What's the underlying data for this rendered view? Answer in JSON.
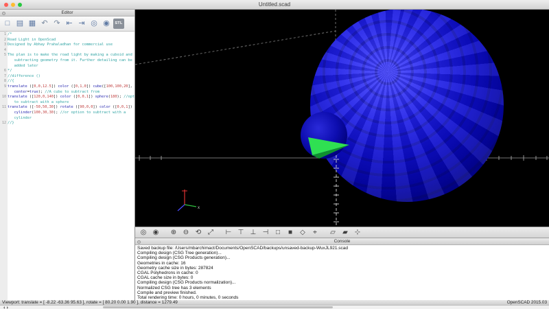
{
  "window": {
    "title": "Untitled.scad"
  },
  "editor": {
    "dock_title": "Editor",
    "toolbar": [
      {
        "name": "new-file",
        "glyph": "□"
      },
      {
        "name": "open-file",
        "glyph": "▤"
      },
      {
        "name": "save-file",
        "glyph": "▦"
      },
      {
        "name": "undo",
        "glyph": "↶"
      },
      {
        "name": "redo",
        "glyph": "↷"
      },
      {
        "name": "unindent",
        "glyph": "⇤"
      },
      {
        "name": "indent",
        "glyph": "⇥"
      },
      {
        "name": "preview",
        "glyph": "◎"
      },
      {
        "name": "render",
        "glyph": "◉"
      },
      {
        "name": "export-stl",
        "glyph": "STL"
      }
    ],
    "code_lines": [
      {
        "no": "1",
        "segs": [
          {
            "c": "cm",
            "t": "/*"
          }
        ]
      },
      {
        "no": "2",
        "segs": [
          {
            "c": "cm",
            "t": "Road Light in OpenScad"
          }
        ]
      },
      {
        "no": "3",
        "segs": [
          {
            "c": "cm",
            "t": "Designed by Abhay Prahaladhan for commercial use"
          }
        ]
      },
      {
        "no": "4",
        "segs": []
      },
      {
        "no": "5",
        "segs": [
          {
            "c": "cm",
            "t": "The plan is to make the road light by making a cuboid and"
          }
        ]
      },
      {
        "no": "",
        "segs": [
          {
            "c": "cm",
            "t": "   subtracting geometry from it. Further detailing can be"
          }
        ]
      },
      {
        "no": "",
        "segs": [
          {
            "c": "cm",
            "t": "   added later"
          }
        ]
      },
      {
        "no": "6",
        "segs": [
          {
            "c": "cm",
            "t": "*/"
          }
        ]
      },
      {
        "no": "7",
        "segs": [
          {
            "c": "cm",
            "t": "//difference ()"
          }
        ]
      },
      {
        "no": "8",
        "segs": [
          {
            "c": "cm",
            "t": "//{"
          }
        ]
      },
      {
        "no": "9",
        "segs": [
          {
            "c": "kw",
            "t": "translate"
          },
          {
            "c": "pl",
            "t": " (["
          },
          {
            "c": "num",
            "t": "0,0,12.5"
          },
          {
            "c": "pl",
            "t": "]) "
          },
          {
            "c": "kw",
            "t": "color"
          },
          {
            "c": "pl",
            "t": " (["
          },
          {
            "c": "num",
            "t": "0,1,0"
          },
          {
            "c": "pl",
            "t": "]) "
          },
          {
            "c": "kw",
            "t": "cube"
          },
          {
            "c": "pl",
            "t": "(["
          },
          {
            "c": "num",
            "t": "100,100,20"
          },
          {
            "c": "pl",
            "t": "],"
          }
        ]
      },
      {
        "no": "",
        "segs": [
          {
            "c": "pl",
            "t": "   "
          },
          {
            "c": "kw",
            "t": "center"
          },
          {
            "c": "pl",
            "t": "="
          },
          {
            "c": "kw",
            "t": "true"
          },
          {
            "c": "pl",
            "t": "); "
          },
          {
            "c": "cm",
            "t": "//A cube to subtract from"
          }
        ]
      },
      {
        "no": "10",
        "segs": [
          {
            "c": "kw",
            "t": "translate"
          },
          {
            "c": "pl",
            "t": " (["
          },
          {
            "c": "num",
            "t": "120,0,140"
          },
          {
            "c": "pl",
            "t": "]) "
          },
          {
            "c": "kw",
            "t": "color"
          },
          {
            "c": "pl",
            "t": " (["
          },
          {
            "c": "num",
            "t": "0,0,1"
          },
          {
            "c": "pl",
            "t": "]) "
          },
          {
            "c": "kw",
            "t": "sphere"
          },
          {
            "c": "pl",
            "t": "("
          },
          {
            "c": "num",
            "t": "180"
          },
          {
            "c": "pl",
            "t": "); "
          },
          {
            "c": "cm",
            "t": "//option"
          }
        ]
      },
      {
        "no": "",
        "segs": [
          {
            "c": "cm",
            "t": "   to subtract with a sphere"
          }
        ]
      },
      {
        "no": "11",
        "segs": [
          {
            "c": "kw",
            "t": "translate"
          },
          {
            "c": "pl",
            "t": " (["
          },
          {
            "c": "num",
            "t": "-50,50,30"
          },
          {
            "c": "pl",
            "t": "]) "
          },
          {
            "c": "kw",
            "t": "rotate"
          },
          {
            "c": "pl",
            "t": " (["
          },
          {
            "c": "num",
            "t": "90,0,0"
          },
          {
            "c": "pl",
            "t": "]) "
          },
          {
            "c": "kw",
            "t": "color"
          },
          {
            "c": "pl",
            "t": " (["
          },
          {
            "c": "num",
            "t": "0,0,1"
          },
          {
            "c": "pl",
            "t": "])"
          }
        ]
      },
      {
        "no": "",
        "segs": [
          {
            "c": "pl",
            "t": "   "
          },
          {
            "c": "kw",
            "t": "cylinder"
          },
          {
            "c": "pl",
            "t": "("
          },
          {
            "c": "num",
            "t": "100,30,30"
          },
          {
            "c": "pl",
            "t": "); "
          },
          {
            "c": "cm",
            "t": "//or option to subtract with a"
          }
        ]
      },
      {
        "no": "",
        "segs": [
          {
            "c": "cm",
            "t": "   cylinder"
          }
        ]
      },
      {
        "no": "12",
        "segs": [
          {
            "c": "cm",
            "t": "//}"
          }
        ]
      }
    ]
  },
  "viewport": {
    "axis_label_x": "x"
  },
  "view_toolbar": [
    {
      "name": "preview",
      "glyph": "◎"
    },
    {
      "name": "render",
      "glyph": "◉"
    },
    {
      "name": "zoom-in",
      "glyph": "⊕",
      "gap": 8
    },
    {
      "name": "zoom-out",
      "glyph": "⊖"
    },
    {
      "name": "reset-view",
      "glyph": "⟲"
    },
    {
      "name": "zoom-all",
      "glyph": "⤢"
    },
    {
      "name": "view-right",
      "glyph": "⊢",
      "gap": 8
    },
    {
      "name": "view-top",
      "glyph": "⊤"
    },
    {
      "name": "view-bottom",
      "glyph": "⊥"
    },
    {
      "name": "view-left",
      "glyph": "⊣"
    },
    {
      "name": "view-front",
      "glyph": "□"
    },
    {
      "name": "view-back",
      "glyph": "■"
    },
    {
      "name": "view-diagonal",
      "glyph": "◇"
    },
    {
      "name": "view-center",
      "glyph": "⌖"
    },
    {
      "name": "perspective",
      "glyph": "▱",
      "gap": 8
    },
    {
      "name": "orthogonal",
      "glyph": "▰"
    },
    {
      "name": "show-crosshairs",
      "glyph": "⊹"
    }
  ],
  "console": {
    "dock_title": "Console",
    "lines": [
      "Saved backup file: /Users/mbarchimact/Documents/OpenSCAD/backups/unsaved-backup-WuxJL921.scad",
      "Compiling design (CSG Tree generation)...",
      "Compiling design (CSG Products generation)...",
      "Geometries in cache: 16",
      "Geometry cache size in bytes: 287824",
      "CGAL Polyhedrons in cache: 0",
      "CGAL cache size in bytes: 0",
      "Compiling design (CSG Products normalization)...",
      "Normalized CSG tree has 3 elements",
      "Compile and preview finished.",
      "Total rendering time: 0 hours, 0 minutes, 0 seconds"
    ]
  },
  "statusbar": {
    "viewport_info": "Viewport: translate = [ -8.22 -63.36 95.63 ], rotate = [ 80.20 0.00 1.90 ], distance = 1279.49",
    "version": "OpenSCAD 2015.03"
  },
  "colors": {
    "sphere_blue": "#1414e0",
    "cylinder_blue": "#0d0db0",
    "cube_green": "#2fe052",
    "comment": "#2fa3a3",
    "keyword": "#2222ae",
    "number": "#bf3a3a"
  }
}
